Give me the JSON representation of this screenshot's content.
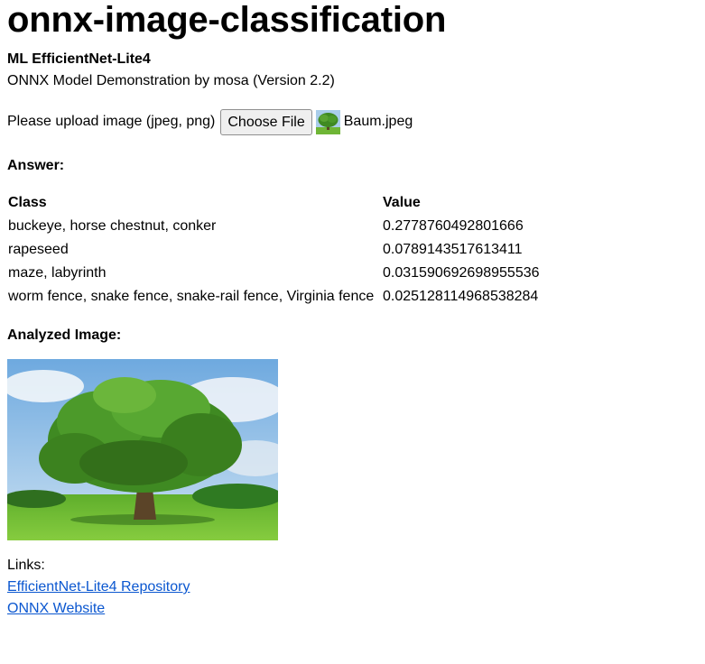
{
  "page": {
    "title": "onnx-image-classification",
    "subtitle": "ML EfficientNet-Lite4",
    "description": "ONNX Model Demonstration by mosa (Version 2.2)"
  },
  "upload": {
    "label": "Please upload image (jpeg, png)",
    "button_label": "Choose File",
    "file_name": "Baum.jpeg",
    "thumbnail_icon": "tree-thumbnail-icon"
  },
  "answer": {
    "label": "Answer:",
    "columns": [
      "Class",
      "Value"
    ],
    "rows": [
      {
        "class": "buckeye, horse chestnut, conker",
        "value": "0.2778760492801666"
      },
      {
        "class": "rapeseed",
        "value": "0.0789143517613411"
      },
      {
        "class": "maze, labyrinth",
        "value": "0.031590692698955536"
      },
      {
        "class": "worm fence, snake fence, snake-rail fence, Virginia fence",
        "value": "0.025128114968538284"
      }
    ]
  },
  "analyzed": {
    "label": "Analyzed Image:"
  },
  "links": {
    "label": "Links:",
    "items": [
      {
        "text": "EfficientNet-Lite4 Repository"
      },
      {
        "text": "ONNX Website"
      }
    ]
  },
  "colors": {
    "link": "#0b57d0",
    "sky": "#8fbfe8",
    "grass": "#7cc43a",
    "foliage": "#3f8a22"
  }
}
